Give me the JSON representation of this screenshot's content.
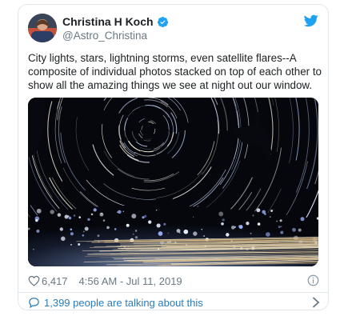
{
  "tweet": {
    "author_name": "Christina H Koch",
    "author_handle": "@Astro_Christina",
    "text": "City lights, stars, lightning storms, even satellite flares--A composite of individual photos stacked on top of each other to show all the amazing things we see at night out our window.",
    "like_count": "6,417",
    "timestamp": "4:56 AM - Jul 11, 2019",
    "conversation_link": "1,399 people are talking about this"
  },
  "icons": {
    "verified": "verified-badge-icon",
    "platform": "twitter-bird-icon",
    "like": "heart-icon",
    "info": "info-icon",
    "conversation": "speech-bubble-icon",
    "chevron": "chevron-right-icon"
  },
  "colors": {
    "link": "#2b7bb9",
    "twitter_blue": "#1da1f2",
    "muted": "#697882",
    "border": "#e1e8ed"
  }
}
